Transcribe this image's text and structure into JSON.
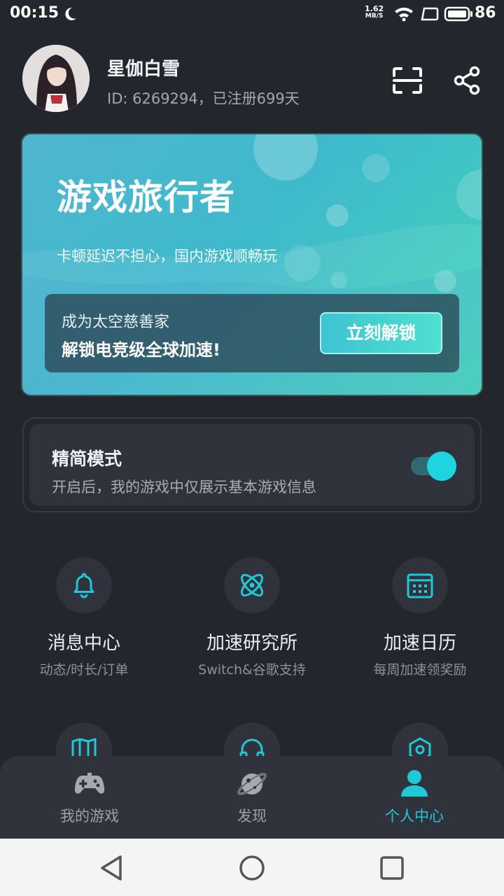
{
  "status_bar": {
    "time": "00:15",
    "net_speed_value": "1.62",
    "net_speed_unit": "MB/S",
    "battery": "86"
  },
  "profile": {
    "username": "星伽白雪",
    "id_text": "ID: 6269294，已注册699天"
  },
  "promo": {
    "title": "游戏旅行者",
    "subtitle": "卡顿延迟不担心，国内游戏顺畅玩",
    "box_line1": "成为太空慈善家",
    "box_line2": "解锁电竞级全球加速!",
    "button_label": "立刻解锁"
  },
  "simple_mode": {
    "title": "精简模式",
    "description": "开启后，我的游戏中仅展示基本游戏信息",
    "enabled": true
  },
  "features": [
    {
      "label": "消息中心",
      "sub": "动态/时长/订单",
      "icon": "bell-icon"
    },
    {
      "label": "加速研究所",
      "sub": "Switch&谷歌支持",
      "icon": "atom-icon"
    },
    {
      "label": "加速日历",
      "sub": "每周加速领奖励",
      "icon": "calendar-icon"
    }
  ],
  "features_row2_icons": [
    "map-icon",
    "headset-icon",
    "shield-settings-icon"
  ],
  "bottom_nav": [
    {
      "label": "我的游戏",
      "icon": "gamepad-icon",
      "active": false
    },
    {
      "label": "发现",
      "icon": "planet-icon",
      "active": false
    },
    {
      "label": "个人中心",
      "icon": "person-icon",
      "active": true
    }
  ],
  "colors": {
    "accent": "#1ec9d8",
    "background": "#24262d",
    "card": "#30333b"
  }
}
